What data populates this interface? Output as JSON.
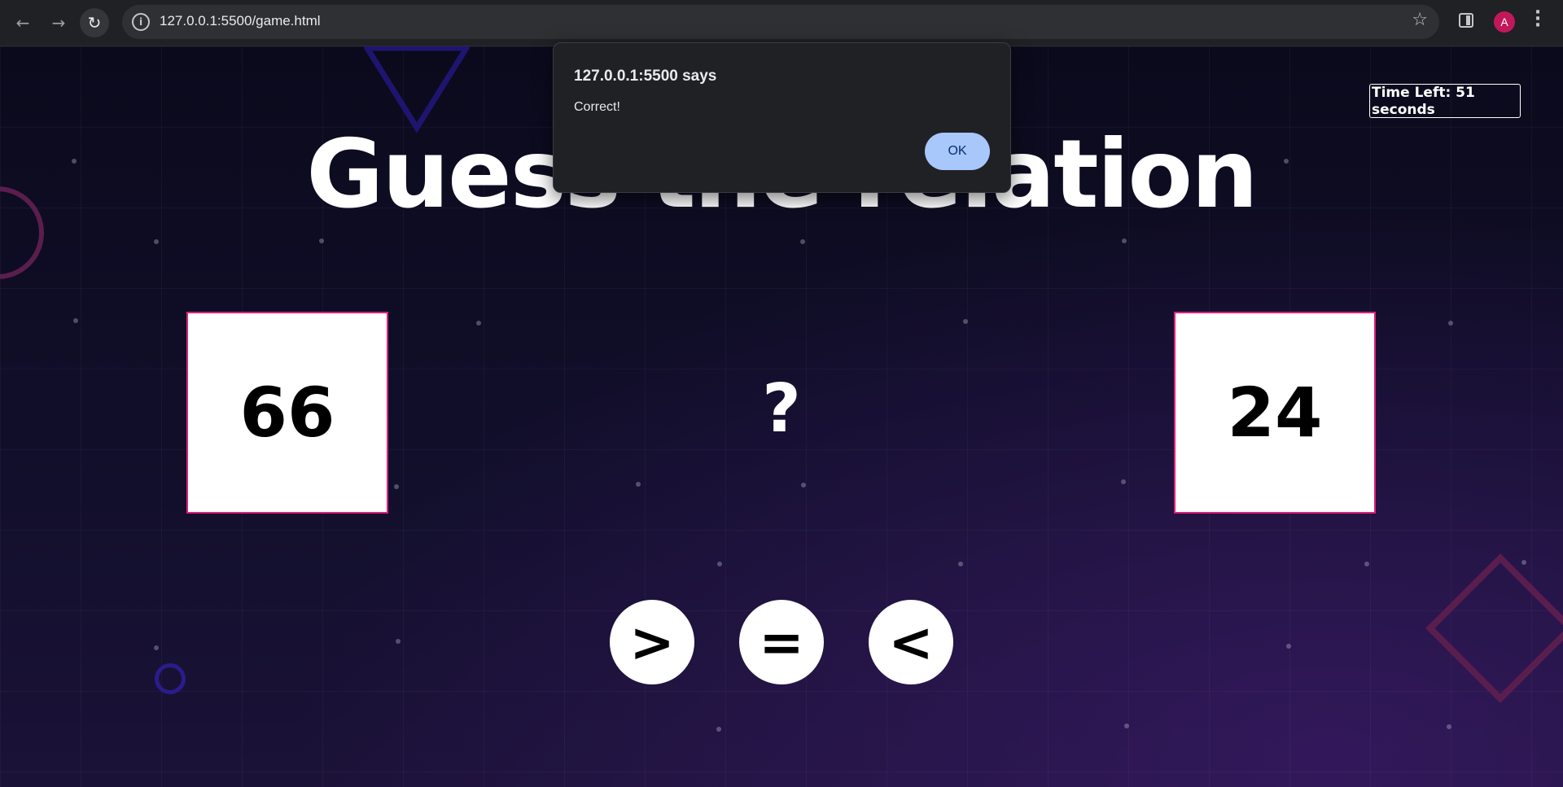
{
  "browser": {
    "url": "127.0.0.1:5500/game.html"
  },
  "profile": {
    "initial": "A"
  },
  "game": {
    "title": "Guess the relation",
    "timer": "Time Left: 51 seconds",
    "left_number": "66",
    "right_number": "24",
    "unknown_relation": "?",
    "operators": {
      "greater": ">",
      "equal": "=",
      "less": "<"
    }
  },
  "dialog": {
    "title": "127.0.0.1:5500 says",
    "message": "Correct!",
    "ok_label": "OK"
  },
  "colors": {
    "card_border": "#e0207a",
    "dialog_button": "#a8c7fa",
    "avatar": "#c2185b"
  }
}
